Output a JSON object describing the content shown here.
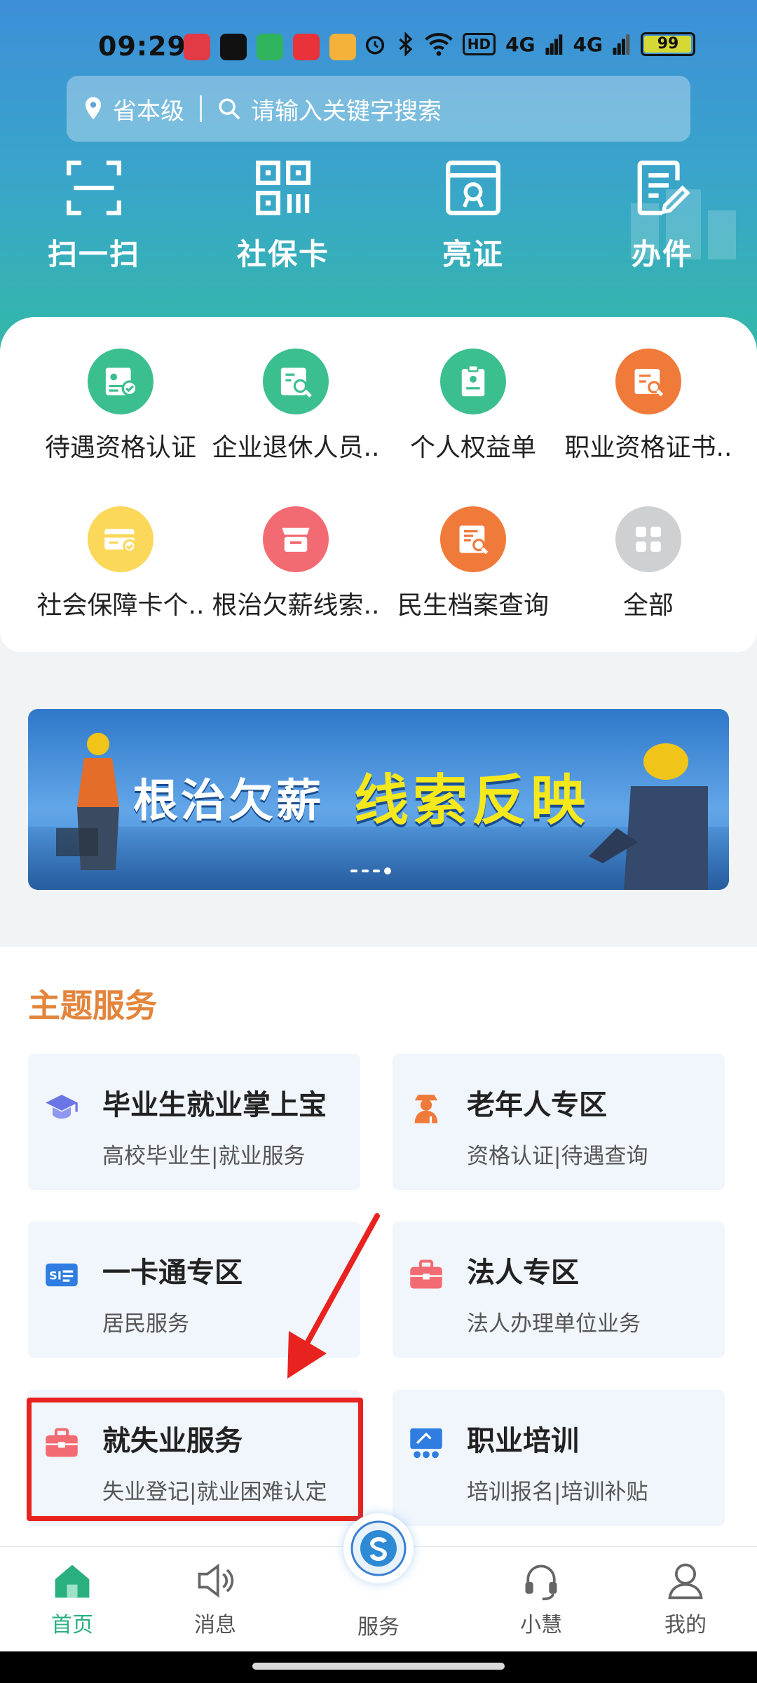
{
  "status_bar": {
    "time": "09:29",
    "network_badge": "HD",
    "signal_1": "4G",
    "signal_2": "4G",
    "battery": "99"
  },
  "search": {
    "location": "省本级",
    "placeholder": "请输入关键字搜索"
  },
  "quick_actions": [
    {
      "label": "扫一扫",
      "icon": "scan-icon"
    },
    {
      "label": "社保卡",
      "icon": "qr-card-icon"
    },
    {
      "label": "亮证",
      "icon": "certificate-icon"
    },
    {
      "label": "办件",
      "icon": "document-edit-icon"
    }
  ],
  "service_grid": [
    {
      "label": "待遇资格认证",
      "color": "#3cbf8f",
      "icon": "id-check-icon"
    },
    {
      "label": "企业退休人员..",
      "color": "#3cbf8f",
      "icon": "profile-search-icon"
    },
    {
      "label": "个人权益单",
      "color": "#3cbf8f",
      "icon": "clipboard-icon"
    },
    {
      "label": "职业资格证书..",
      "color": "#f07a3a",
      "icon": "certificate-search-icon"
    },
    {
      "label": "社会保障卡个..",
      "color": "#fbd85a",
      "icon": "card-check-icon"
    },
    {
      "label": "根治欠薪线索..",
      "color": "#f36b72",
      "icon": "inbox-icon"
    },
    {
      "label": "民生档案查询",
      "color": "#f07a3a",
      "icon": "archive-search-icon"
    },
    {
      "label": "全部",
      "color": "#cfd0d2",
      "icon": "grid-icon"
    }
  ],
  "banner": {
    "text_main": "根治欠薪",
    "text_highlight": "线索反映"
  },
  "theme_services": {
    "title": "主题服务",
    "items": [
      {
        "name": "毕业生就业掌上宝",
        "sub": "高校毕业生|就业服务",
        "icon": "graduation-cap-icon",
        "icon_color": "#6b76e6"
      },
      {
        "name": "老年人专区",
        "sub": "资格认证|待遇查询",
        "icon": "elderly-icon",
        "icon_color": "#f07a3a"
      },
      {
        "name": "一卡通专区",
        "sub": "居民服务",
        "icon": "si-card-icon",
        "icon_color": "#2f7de0"
      },
      {
        "name": "法人专区",
        "sub": "法人办理单位业务",
        "icon": "briefcase-icon",
        "icon_color": "#f36b72"
      },
      {
        "name": "就失业服务",
        "sub": "失业登记|就业困难认定",
        "icon": "briefcase-icon",
        "icon_color": "#f36b72"
      },
      {
        "name": "职业培训",
        "sub": "培训报名|培训补贴",
        "icon": "training-icon",
        "icon_color": "#2f7de0"
      }
    ]
  },
  "bottom_nav": [
    {
      "label": "首页",
      "icon": "home-icon",
      "active": true
    },
    {
      "label": "消息",
      "icon": "speaker-icon",
      "active": false
    },
    {
      "label": "服务",
      "icon": "service-logo-icon",
      "active": false
    },
    {
      "label": "小慧",
      "icon": "headset-icon",
      "active": false
    },
    {
      "label": "我的",
      "icon": "user-icon",
      "active": false
    }
  ],
  "colors": {
    "accent_green": "#2ab07f",
    "theme_title": "#e3853c",
    "highlight_red": "#e8231f"
  }
}
